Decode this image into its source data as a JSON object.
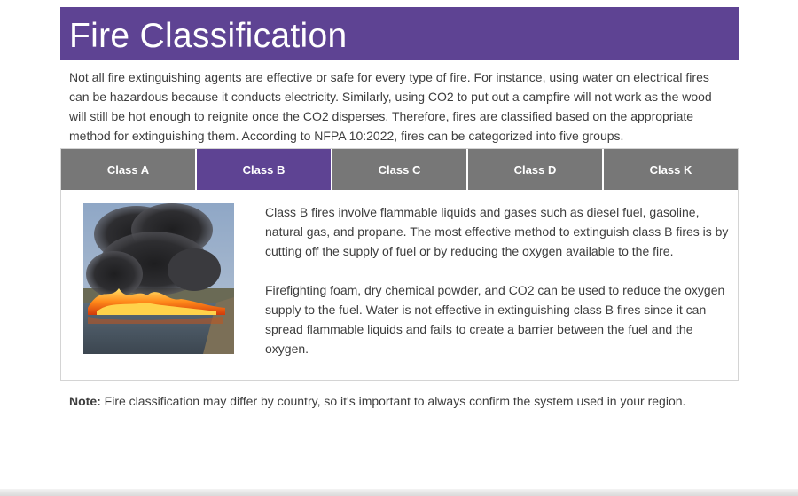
{
  "header": {
    "title": "Fire Classification"
  },
  "intro": {
    "text": "Not all fire extinguishing agents are effective or safe for every type of fire. For instance, using water on electrical fires can be hazardous because it conducts electricity. Similarly, using CO2 to put out a campfire will not work as the wood will still be hot enough to reignite once the CO2 disperses. Therefore, fires are classified based on the appropriate method for extinguishing them. According to NFPA 10:2022, fires can be categorized into five groups."
  },
  "tabs": {
    "items": [
      {
        "label": "Class A"
      },
      {
        "label": "Class B"
      },
      {
        "label": "Class C"
      },
      {
        "label": "Class D"
      },
      {
        "label": "Class K"
      }
    ],
    "selected": "Class B",
    "active_color": "#5e4393",
    "inactive_color": "#777777"
  },
  "panel": {
    "image_icon": "burning-liquid-fire-photo",
    "paragraphs": [
      "Class B fires involve flammable liquids and gases such as diesel fuel, gasoline, natural gas, and propane. The most effective method to extinguish class B fires is by cutting off the supply of fuel or by reducing the oxygen available to the fire.",
      "Firefighting foam, dry chemical powder, and CO2 can be used to reduce the oxygen supply to the fuel. Water is not effective in extinguishing class B fires since it can spread flammable liquids and fails to create a barrier between the fuel and the oxygen."
    ]
  },
  "note": {
    "label": "Note:",
    "text": " Fire classification may differ by country, so it's important to always confirm the system used in your region."
  },
  "colors": {
    "brand": "#5e4393",
    "text": "#3d3d3d"
  }
}
